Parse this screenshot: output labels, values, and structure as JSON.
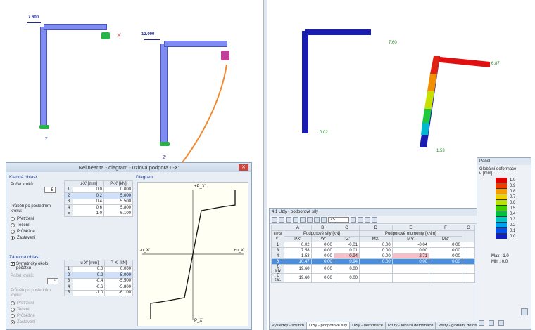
{
  "left_view": {
    "loads": [
      "7.600",
      "12.000"
    ],
    "axes": {
      "x": "X'",
      "y": "Y'",
      "z": "Z",
      "zprime": "Z'"
    }
  },
  "right_view": {
    "labels": [
      "7.60",
      "0.02",
      "1.53",
      "6.87"
    ]
  },
  "dialog": {
    "title": "Nelinearita - diagram - uzlová podpora u-X'",
    "close": "✕",
    "positive": {
      "group": "Kladná oblast",
      "steps_label": "Počet kroků:",
      "steps_value": "5",
      "after_label": "Průběh po posledním kroku:",
      "options": [
        "Přetržení",
        "Tečení",
        "Průběžné",
        "Zastavení"
      ],
      "selected": 3,
      "col_u": "u-X' [mm]",
      "col_p": "P-X' [kN]",
      "rows": [
        {
          "n": "1",
          "u": "0.0",
          "p": "0.000"
        },
        {
          "n": "2",
          "u": "0.2",
          "p": "5.000"
        },
        {
          "n": "3",
          "u": "0.4",
          "p": "5.500"
        },
        {
          "n": "4",
          "u": "0.6",
          "p": "5.800"
        },
        {
          "n": "5",
          "u": "1.0",
          "p": "6.100"
        }
      ]
    },
    "negative": {
      "group": "Záporná oblast",
      "symmetric_label": "Symetricky okolo počátku",
      "steps_label": "Počet kroků:",
      "steps_value": "5",
      "after_label": "Průběh po posledním kroku:",
      "options": [
        "Přetržení",
        "Tečení",
        "Průběžné",
        "Zastavení"
      ],
      "selected": 3,
      "col_u": "-u-X' [mm]",
      "col_p": "P-X' [kN]",
      "rows": [
        {
          "n": "1",
          "u": "0.0",
          "p": "0.000"
        },
        {
          "n": "2",
          "u": "-0.2",
          "p": "-5.000"
        },
        {
          "n": "3",
          "u": "-0.4",
          "p": "-5.500"
        },
        {
          "n": "4",
          "u": "-0.6",
          "p": "-5.800"
        },
        {
          "n": "5",
          "u": "-1.0",
          "p": "-6.100"
        }
      ]
    },
    "diagram": {
      "group": "Diagram",
      "top": "+P_X'",
      "bottom": "P_X'",
      "left": "-u_X'",
      "right": "+u_X'"
    }
  },
  "results": {
    "title": "4.1 Uzly - podporové síly",
    "combo": "ZS1",
    "col_letters": [
      "A",
      "B",
      "C",
      "D",
      "E",
      "F",
      "G"
    ],
    "group_headers": {
      "forces": "Podporové síly [kN]",
      "moments": "Podporové momenty [kNm]"
    },
    "col_heads": [
      "Uzel č.",
      "PX'",
      "PY'",
      "PZ'",
      "MX'",
      "MY'",
      "MZ'"
    ],
    "rows": [
      {
        "n": "1",
        "px": "0.02",
        "py": "0.00",
        "pz": "-0.01",
        "mx": "0.00",
        "my": "-0.04",
        "mz": "0.00"
      },
      {
        "n": "3",
        "px": "7.58",
        "py": "0.00",
        "pz": "0.01",
        "mx": "0.00",
        "my": "0.00",
        "mz": "0.00"
      },
      {
        "n": "4",
        "px": "1.53",
        "py": "0.00",
        "pz": "-0.94",
        "mx": "0.00",
        "my": "-2.71",
        "mz": "0.00"
      },
      {
        "n": "6",
        "px": "10.47",
        "py": "0.00",
        "pz": "0.94",
        "mx": "0.00",
        "my": "0.00",
        "mz": "0.00"
      },
      {
        "n": "Σ síly",
        "px": "19.60",
        "py": "0.00",
        "pz": "0.00",
        "mx": "",
        "my": "",
        "mz": ""
      },
      {
        "n": "Σ zat.",
        "px": "19.60",
        "py": "0.00",
        "pz": "0.00",
        "mx": "",
        "my": "",
        "mz": ""
      }
    ],
    "tabs": [
      "Výsledky - souhrn",
      "Uzly - podporové síly",
      "Uzly - deformace",
      "Pruty - lokální deformace",
      "Pruty - globální deformace"
    ],
    "active_tab": 1
  },
  "panel": {
    "title": "Panel",
    "subtitle": "Globální deformace",
    "unit": "u [mm]",
    "legend": [
      {
        "v": "1.0",
        "c": "#e00000"
      },
      {
        "v": "0.9",
        "c": "#f03a00"
      },
      {
        "v": "0.8",
        "c": "#f59a00"
      },
      {
        "v": "0.7",
        "c": "#f0d000"
      },
      {
        "v": "0.6",
        "c": "#b8e000"
      },
      {
        "v": "0.5",
        "c": "#40d000"
      },
      {
        "v": "0.4",
        "c": "#00c040"
      },
      {
        "v": "0.3",
        "c": "#00c8c0"
      },
      {
        "v": "0.2",
        "c": "#00a0f0"
      },
      {
        "v": "0.1",
        "c": "#0050f0"
      },
      {
        "v": "0.0",
        "c": "#1020c0"
      }
    ],
    "max_label": "Max :",
    "max_value": "1.0",
    "min_label": "Min :",
    "min_value": "0.0"
  }
}
